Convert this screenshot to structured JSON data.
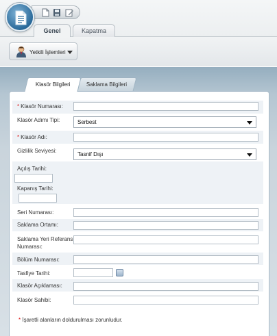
{
  "header": {
    "tabs": [
      {
        "label": "Genel",
        "active": true
      },
      {
        "label": "Kapatma",
        "active": false
      }
    ],
    "quick_access": [
      "new-document-icon",
      "save-icon",
      "edit-icon"
    ],
    "authorized_operations": {
      "label": "Yetkili İşlemleri",
      "icon": "user-icon"
    }
  },
  "form_tabs": [
    {
      "label": "Klasör Bilgileri",
      "active": true
    },
    {
      "label": "Saklama Bilgileri",
      "active": false
    }
  ],
  "form": {
    "klasor_numarasi": {
      "label": "Klasör Numarası:",
      "required": true,
      "value": ""
    },
    "klasor_adimi_tipi": {
      "label": "Klasör Adımı Tipi:",
      "value": "Serbest"
    },
    "klasor_adi": {
      "label": "Klasör Adı:",
      "required": true,
      "value": ""
    },
    "gizlilik_seviyesi": {
      "label": "Gizlilik Seviyesi:",
      "value": "Tasnif Dışı"
    },
    "acilis_tarihi": {
      "label": "Açılış Tarihi:",
      "value": ""
    },
    "kapanis_tarihi": {
      "label": "Kapanış Tarihi:",
      "value": ""
    },
    "seri_numarasi": {
      "label": "Seri Numarası:",
      "value": ""
    },
    "saklama_ortami": {
      "label": "Saklama Ortamı:",
      "value": ""
    },
    "saklama_yeri_referans_numarasi": {
      "label_line1": "Saklama Yeri Referans",
      "label_line2": "Numarası:",
      "value": ""
    },
    "bolum_numarasi": {
      "label": "Bölüm Numarası:",
      "value": ""
    },
    "tasfiye_tarihi": {
      "label": "Tasfiye Tarihi:",
      "value": ""
    },
    "klasor_aciklamasi": {
      "label": "Klasör Açıklaması:",
      "value": ""
    },
    "klasor_sahibi": {
      "label": "Klasör Sahibi:",
      "value": ""
    }
  },
  "required_marker": "*",
  "footer_note": "İşaretli alanların doldurulması zorunludur.",
  "colors": {
    "required": "#dd1111",
    "panel_background": "#ffffff",
    "row_stripe": "#eef2f6",
    "area_top": "#95aebf"
  }
}
